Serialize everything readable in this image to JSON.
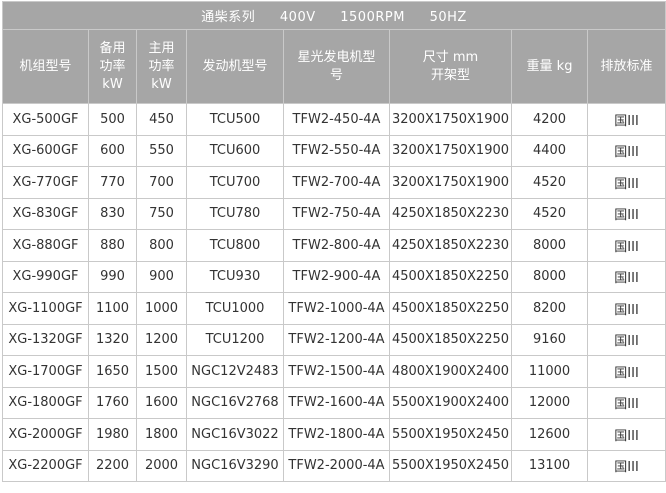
{
  "banner": {
    "series": "通柴系列",
    "voltage": "400V",
    "rpm": "1500RPM",
    "frequency": "50HZ"
  },
  "columns": [
    [
      "机组型号"
    ],
    [
      "备用",
      "功率",
      "kW"
    ],
    [
      "主用",
      "功率",
      "kW"
    ],
    [
      "发动机型号"
    ],
    [
      "星光发电机型",
      "号"
    ],
    [
      "尺寸 mm",
      "开架型"
    ],
    [
      "重量 kg"
    ],
    [
      "排放标准"
    ]
  ],
  "rows": [
    [
      "XG-500GF",
      "500",
      "450",
      "TCU500",
      "TFW2-450-4A",
      "3200X1750X1900",
      "4200",
      "国III"
    ],
    [
      "XG-600GF",
      "600",
      "550",
      "TCU600",
      "TFW2-550-4A",
      "3200X1750X1900",
      "4400",
      "国III"
    ],
    [
      "XG-770GF",
      "770",
      "700",
      "TCU700",
      "TFW2-700-4A",
      "3200X1750X1900",
      "4520",
      "国III"
    ],
    [
      "XG-830GF",
      "830",
      "750",
      "TCU780",
      "TFW2-750-4A",
      "4250X1850X2230",
      "4520",
      "国III"
    ],
    [
      "XG-880GF",
      "880",
      "800",
      "TCU800",
      "TFW2-800-4A",
      "4250X1850X2230",
      "8000",
      "国III"
    ],
    [
      "XG-990GF",
      "990",
      "900",
      "TCU930",
      "TFW2-900-4A",
      "4500X1850X2250",
      "8000",
      "国III"
    ],
    [
      "XG-1100GF",
      "1100",
      "1000",
      "TCU1000",
      "TFW2-1000-4A",
      "4500X1850X2250",
      "8200",
      "国III"
    ],
    [
      "XG-1320GF",
      "1320",
      "1200",
      "TCU1200",
      "TFW2-1200-4A",
      "4500X1850X2250",
      "9160",
      "国III"
    ],
    [
      "XG-1700GF",
      "1650",
      "1500",
      "NGC12V2483",
      "TFW2-1500-4A",
      "4800X1900X2400",
      "11000",
      "国III"
    ],
    [
      "XG-1800GF",
      "1760",
      "1600",
      "NGC16V2768",
      "TFW2-1600-4A",
      "5500X1900X2400",
      "12000",
      "国III"
    ],
    [
      "XG-2000GF",
      "1980",
      "1800",
      "NGC16V3022",
      "TFW2-1800-4A",
      "5500X1950X2450",
      "12600",
      "国III"
    ],
    [
      "XG-2200GF",
      "2200",
      "2000",
      "NGC16V3290",
      "TFW2-2000-4A",
      "5500X1950X2450",
      "13100",
      "国III"
    ]
  ]
}
